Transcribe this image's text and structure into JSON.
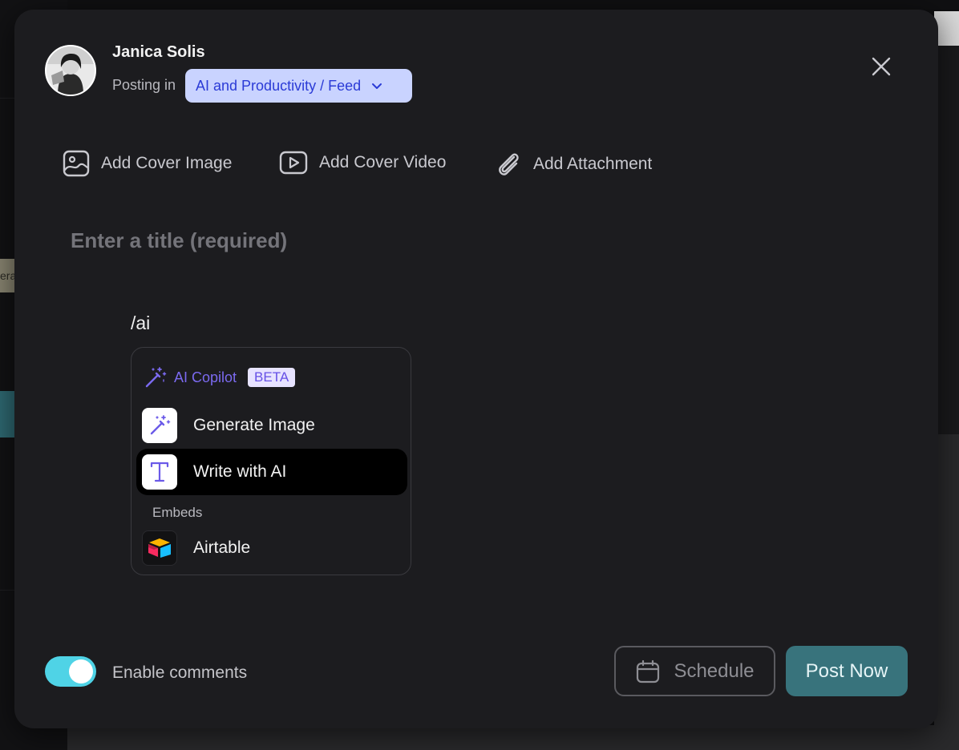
{
  "author": {
    "name": "Janica Solis",
    "posting_in_label": "Posting in"
  },
  "space": {
    "selected": "AI and Productivity / Feed"
  },
  "toolbar": {
    "cover_image": "Add Cover Image",
    "cover_video": "Add Cover Video",
    "attachment": "Add Attachment"
  },
  "title": {
    "placeholder": "Enter a title (required)",
    "value": ""
  },
  "editor": {
    "text": "/ai"
  },
  "command_menu": {
    "header": "AI Copilot",
    "badge": "BETA",
    "items": [
      {
        "label": "Generate Image",
        "icon": "magic-wand-icon",
        "selected": false
      },
      {
        "label": "Write with AI",
        "icon": "text-t-icon",
        "selected": true
      }
    ],
    "embeds_label": "Embeds",
    "embeds": [
      {
        "label": "Airtable",
        "icon": "airtable-logo-icon"
      }
    ]
  },
  "comments": {
    "label": "Enable comments",
    "enabled": true
  },
  "actions": {
    "schedule": "Schedule",
    "post": "Post Now"
  },
  "colors": {
    "accent_purple": "#7b6af0",
    "space_pill_bg": "#c9d3ff",
    "space_pill_text": "#2b3bd6",
    "toggle_on": "#4fd3e6",
    "post_button": "#38737c"
  },
  "background": {
    "partial_tag_text": "era"
  }
}
